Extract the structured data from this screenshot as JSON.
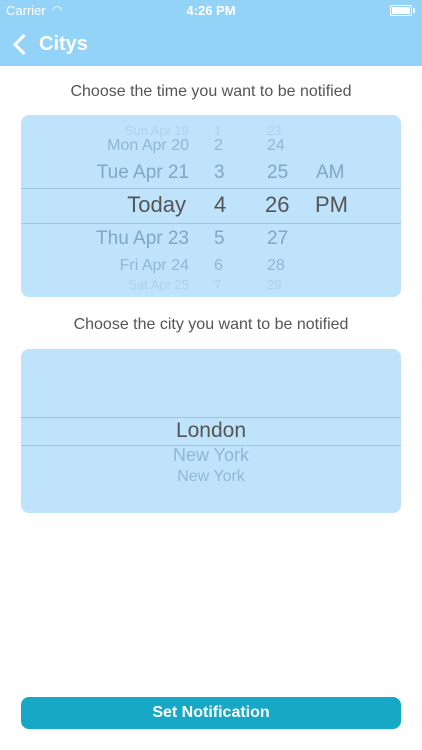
{
  "status_bar": {
    "carrier": "Carrier",
    "time": "4:26 PM"
  },
  "nav": {
    "back_label": "Citys"
  },
  "time_section": {
    "title": "Choose the time you want to be notified",
    "rows": [
      {
        "date": "Sun Apr 19",
        "hour": "1",
        "minute": "23",
        "ampm": ""
      },
      {
        "date": "Mon Apr 20",
        "hour": "2",
        "minute": "24",
        "ampm": ""
      },
      {
        "date": "Tue Apr 21",
        "hour": "3",
        "minute": "25",
        "ampm": "AM"
      },
      {
        "date": "Today",
        "hour": "4",
        "minute": "26",
        "ampm": "PM"
      },
      {
        "date": "Thu Apr 23",
        "hour": "5",
        "minute": "27",
        "ampm": ""
      },
      {
        "date": "Fri Apr 24",
        "hour": "6",
        "minute": "28",
        "ampm": ""
      },
      {
        "date": "Sat Apr 25",
        "hour": "7",
        "minute": "29",
        "ampm": ""
      }
    ]
  },
  "city_section": {
    "title": "Choose the city you want to be notified",
    "options": [
      "London",
      "New York",
      "New York"
    ]
  },
  "action": {
    "label": "Set Notification"
  }
}
